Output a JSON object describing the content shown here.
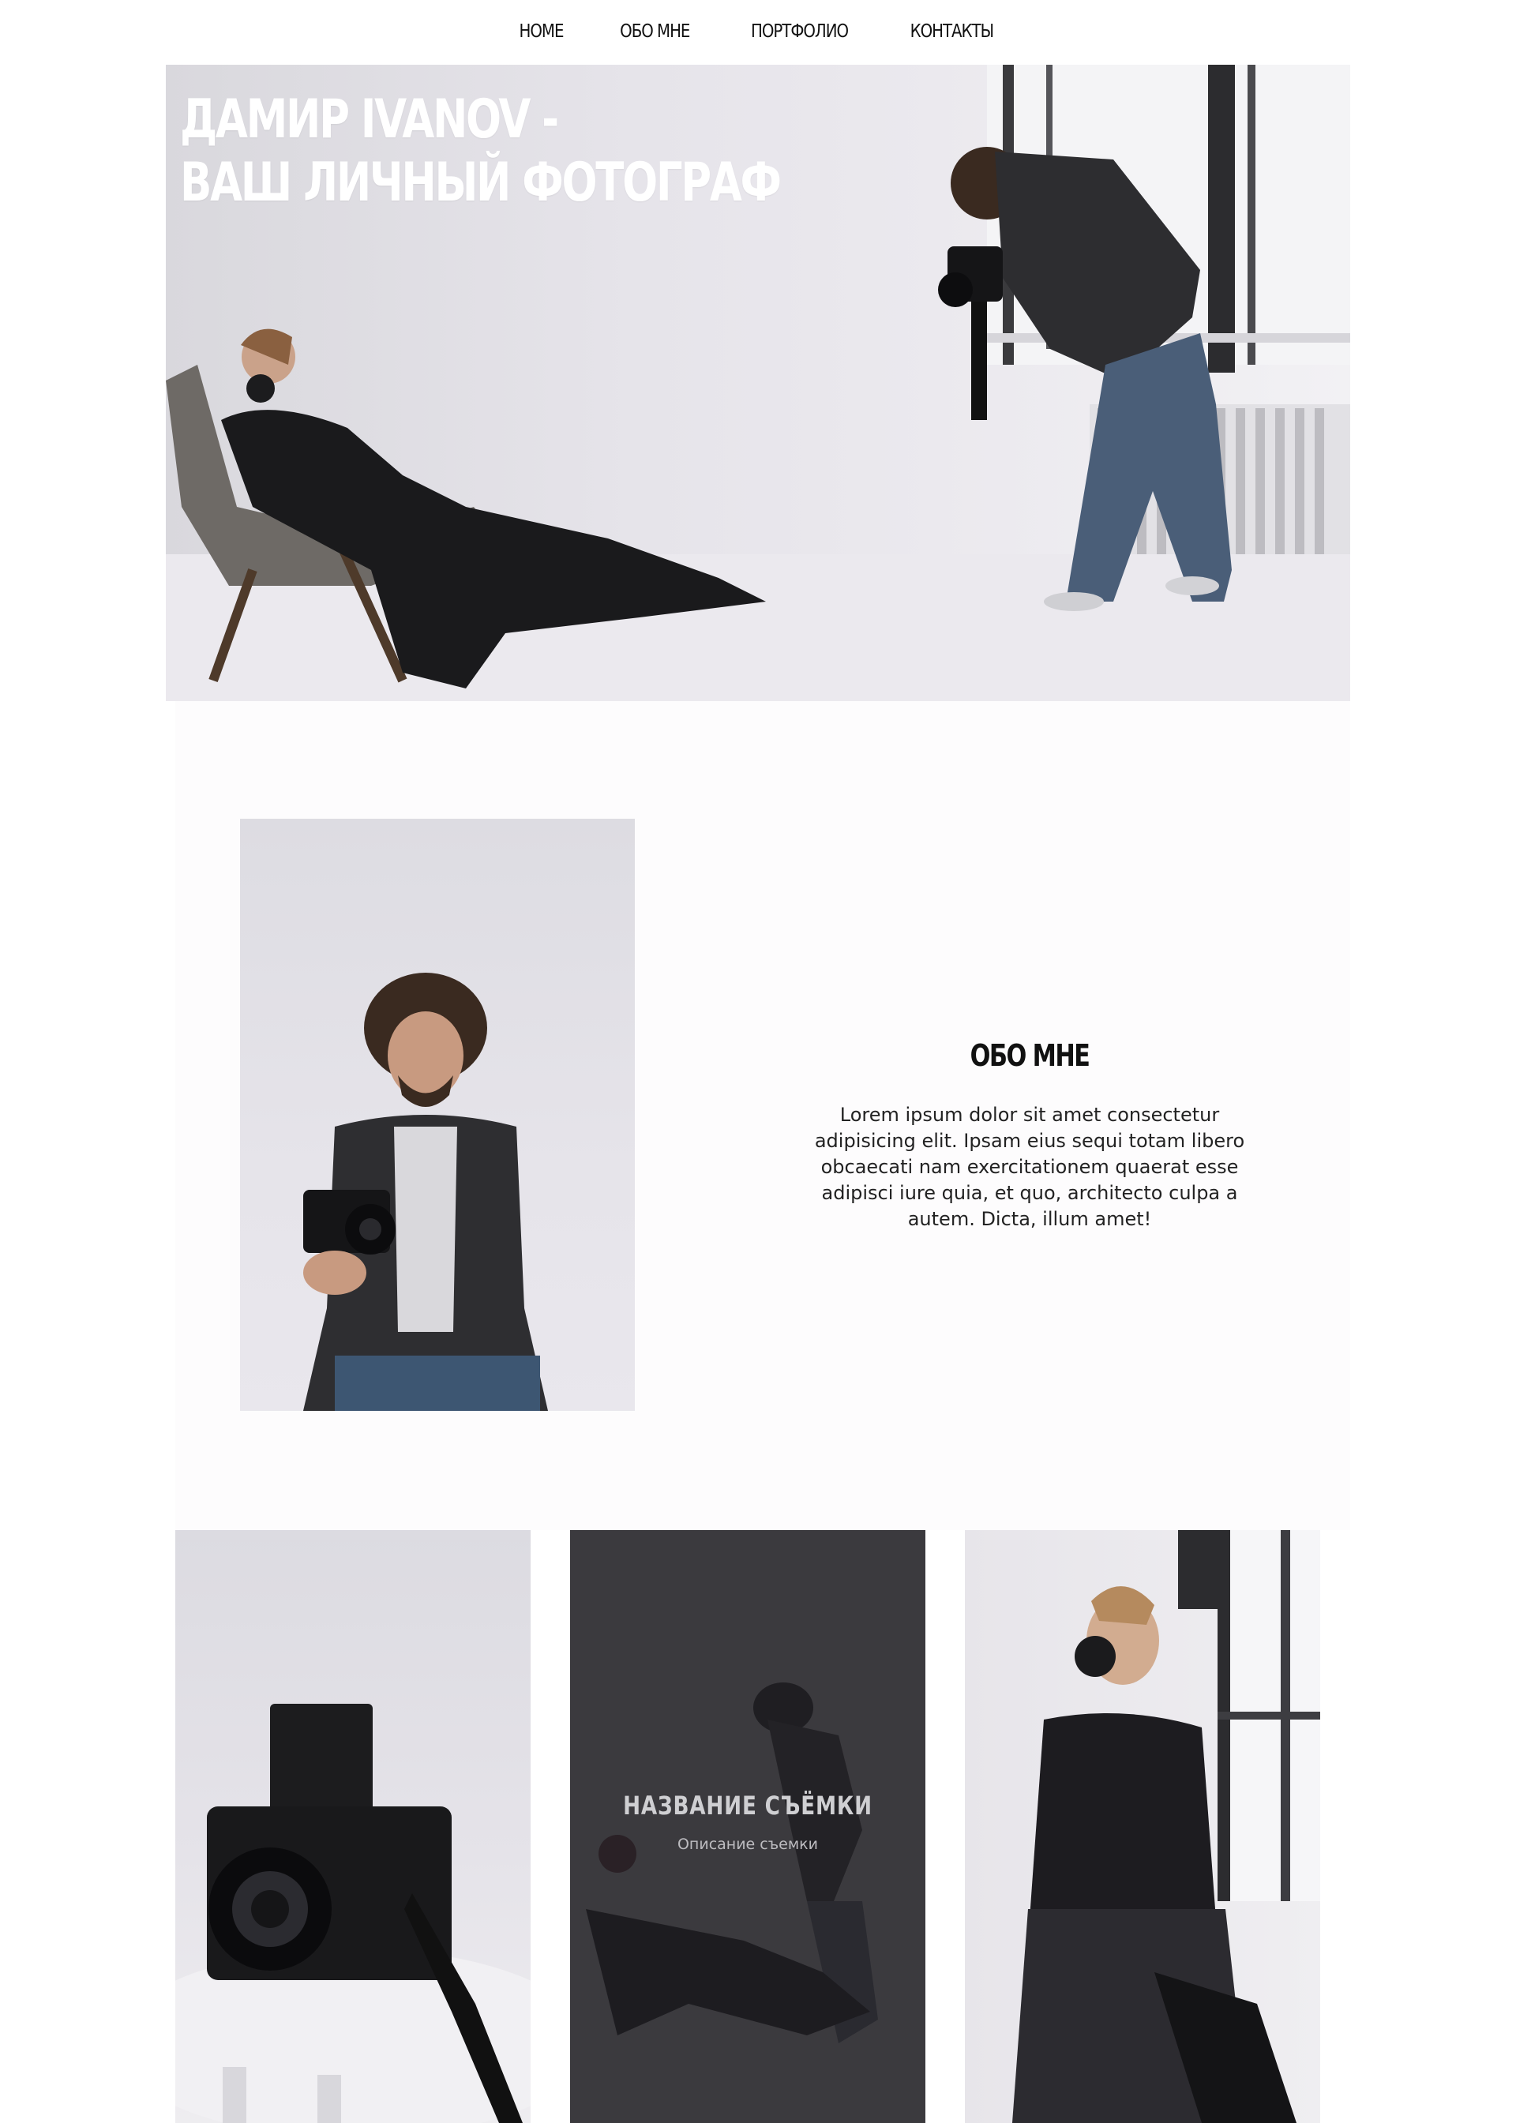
{
  "nav": {
    "items": [
      {
        "label": "HOME"
      },
      {
        "label": "ОБО МНЕ"
      },
      {
        "label": "ПОРТФОЛИО"
      },
      {
        "label": "КОНТАКТЫ"
      }
    ]
  },
  "hero": {
    "title_line1": "ДАМИР IVANOV -",
    "title_line2": "ВАШ ЛИЧНЫЙ ФОТОГРАФ"
  },
  "about": {
    "title": "ОБО МНЕ",
    "text": "Lorem ipsum dolor sit amet consectetur adipisicing elit. Ipsam eius sequi totam libero obcaecati nam exercitationem quaerat esse adipisci iure quia, et quo, architecto culpa a autem. Dicta, illum amet!"
  },
  "gallery": {
    "featured": {
      "title": "НАЗВАНИЕ СЪЁМКИ",
      "description": "Описание съемки"
    }
  },
  "colors": {
    "text": "#111111",
    "overlay": "#3b3a3e",
    "background": "#ffffff"
  }
}
